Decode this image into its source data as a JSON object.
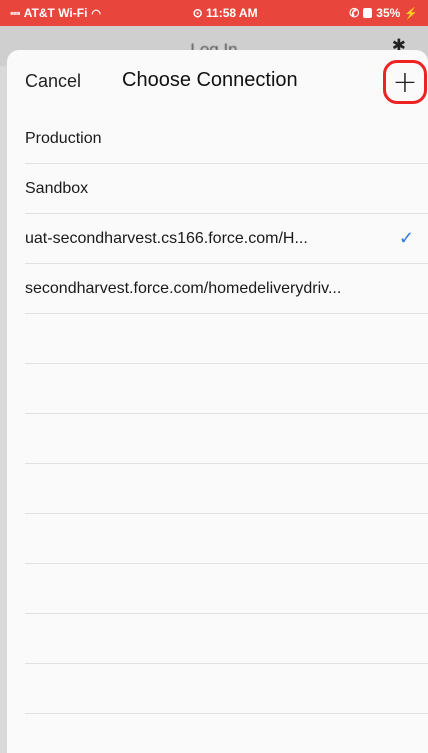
{
  "status_bar": {
    "carrier": "AT&T Wi-Fi",
    "time": "11:58 AM",
    "battery": "35%"
  },
  "underlay": {
    "title": "Log In"
  },
  "nav": {
    "cancel_label": "Cancel",
    "title": "Choose Connection",
    "add_label": "+"
  },
  "connections": [
    {
      "label": "Production",
      "selected": false
    },
    {
      "label": "Sandbox",
      "selected": false
    },
    {
      "label": "uat-secondharvest.cs166.force.com/H...",
      "selected": true
    },
    {
      "label": "secondharvest.force.com/homedeliverydriv...",
      "selected": false
    }
  ],
  "empty_rows": 8,
  "colors": {
    "status_bar": "#e8453c",
    "add_highlight": "#ee2222",
    "checkmark": "#2f7de1"
  }
}
